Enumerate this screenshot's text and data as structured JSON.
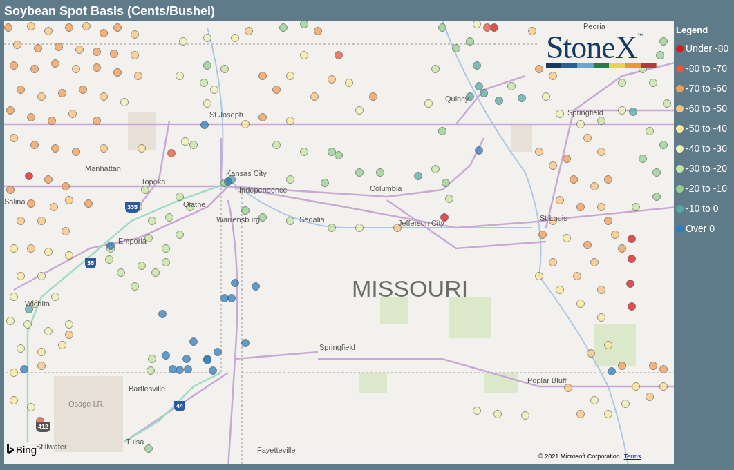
{
  "title": "Soybean Spot Basis (Cents/Bushel)",
  "map": {
    "region_label": "MISSOURI",
    "places": [
      {
        "name": "Peoria",
        "kind": "city"
      },
      {
        "name": "St Joseph",
        "kind": "city"
      },
      {
        "name": "Quincy",
        "kind": "city"
      },
      {
        "name": "Springfield",
        "kind": "city"
      },
      {
        "name": "Manhattan",
        "kind": "city"
      },
      {
        "name": "Topeka",
        "kind": "city"
      },
      {
        "name": "Kansas City",
        "kind": "city"
      },
      {
        "name": "Independence",
        "kind": "city"
      },
      {
        "name": "Columbia",
        "kind": "city"
      },
      {
        "name": "Salina",
        "kind": "city"
      },
      {
        "name": "Olathe",
        "kind": "city"
      },
      {
        "name": "Warrensburg",
        "kind": "city"
      },
      {
        "name": "Sedalia",
        "kind": "city"
      },
      {
        "name": "Jefferson City",
        "kind": "city"
      },
      {
        "name": "St Louis",
        "kind": "city"
      },
      {
        "name": "Emporia",
        "kind": "city"
      },
      {
        "name": "Wichita",
        "kind": "city"
      },
      {
        "name": "Springfield",
        "kind": "city"
      },
      {
        "name": "Bartlesville",
        "kind": "city"
      },
      {
        "name": "Osage I.R.",
        "kind": "area"
      },
      {
        "name": "Poplar Bluff",
        "kind": "city"
      },
      {
        "name": "Stillwater",
        "kind": "city"
      },
      {
        "name": "Tulsa",
        "kind": "city"
      },
      {
        "name": "Fayetteville",
        "kind": "city"
      }
    ],
    "shields": [
      "335",
      "35",
      "44",
      "412"
    ],
    "provider": "Bing",
    "copyright": "© 2021 Microsoft Corporation",
    "terms_link": "Terms"
  },
  "logo": {
    "text": "StoneX",
    "trademark": "™"
  },
  "legend": {
    "title": "Legend",
    "items": [
      {
        "label": "Under -80",
        "color": "#d7191c"
      },
      {
        "label": "-80 to -70",
        "color": "#e8553a"
      },
      {
        "label": "-70 to -60",
        "color": "#f39c55"
      },
      {
        "label": "-60 to -50",
        "color": "#fdc47d"
      },
      {
        "label": "-50 to -40",
        "color": "#fee89a"
      },
      {
        "label": "-40 to -30",
        "color": "#eef3b5"
      },
      {
        "label": "-30 to -20",
        "color": "#c6e6a0"
      },
      {
        "label": "-20 to -10",
        "color": "#95cf8f"
      },
      {
        "label": "-10 to 0",
        "color": "#55a8a5"
      },
      {
        "label": "Over 0",
        "color": "#2b7fc1"
      }
    ]
  }
}
